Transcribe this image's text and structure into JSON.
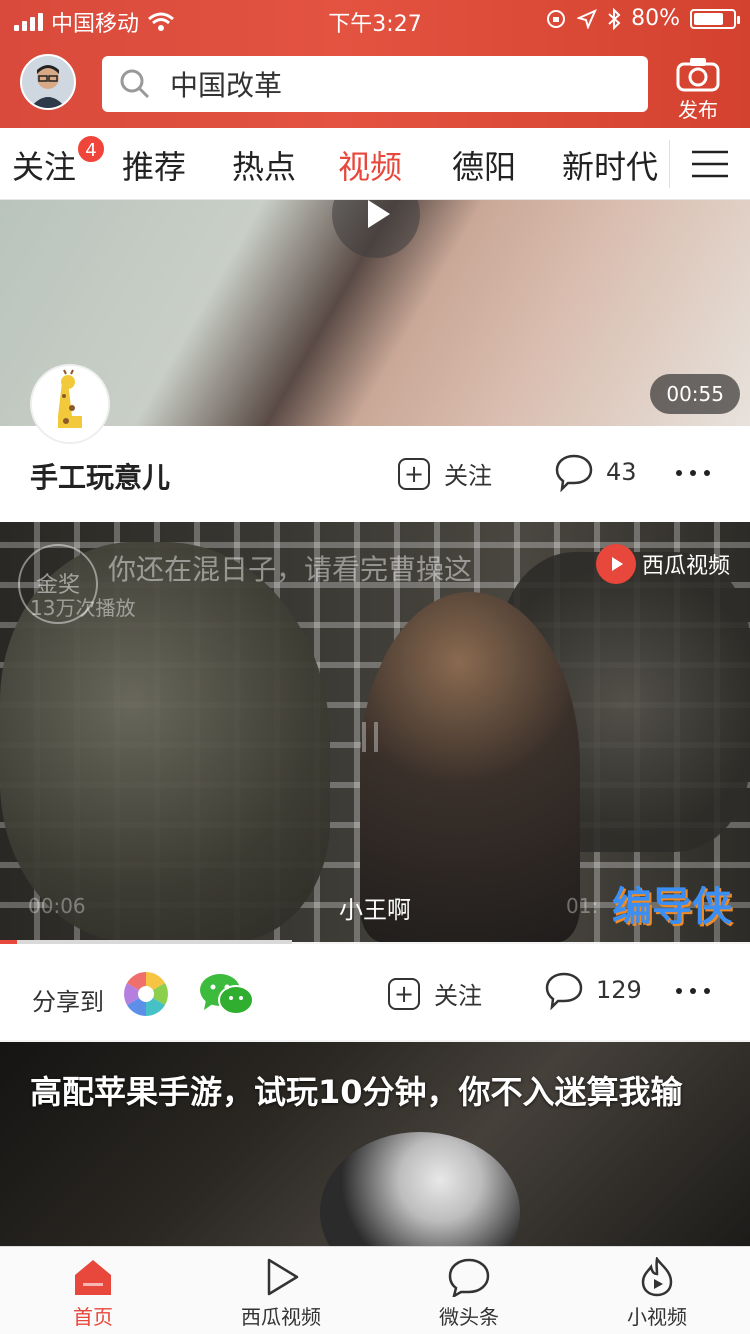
{
  "status_bar": {
    "carrier": "中国移动",
    "time": "下午3:27",
    "battery": "80%",
    "battery_level": 0.8
  },
  "header": {
    "search_text": "中国改革",
    "publish_label": "发布"
  },
  "tabs": [
    {
      "label": "关注",
      "badge": "4"
    },
    {
      "label": "推荐"
    },
    {
      "label": "热点"
    },
    {
      "label": "视频",
      "active": true
    },
    {
      "label": "德阳"
    },
    {
      "label": "新时代"
    }
  ],
  "video1": {
    "duration": "00:55",
    "channel": "手工玩意儿",
    "follow_label": "关注",
    "comments": "43"
  },
  "video2": {
    "overlay_title": "你还在混日子，请看完曹操这",
    "overlay_plays": "13万次播放",
    "award_text": "金奖",
    "xigua_logo_text": "西瓜视频",
    "subtitle": "小王啊",
    "time_elapsed": "00:06",
    "time_total": "01:",
    "brand_text": "编导侠",
    "progress": 0.39,
    "share_label": "分享到",
    "follow_label": "关注",
    "comments": "129"
  },
  "video3": {
    "title": "高配苹果手游，试玩10分钟，你不入迷算我输"
  },
  "bottom_nav": [
    {
      "label": "首页",
      "icon": "home-icon",
      "active": true
    },
    {
      "label": "西瓜视频",
      "icon": "play-icon"
    },
    {
      "label": "微头条",
      "icon": "chat-bubble-icon"
    },
    {
      "label": "小视频",
      "icon": "flame-play-icon"
    }
  ],
  "colors": {
    "accent": "#e8473b",
    "header_red": "#d94a3c"
  }
}
